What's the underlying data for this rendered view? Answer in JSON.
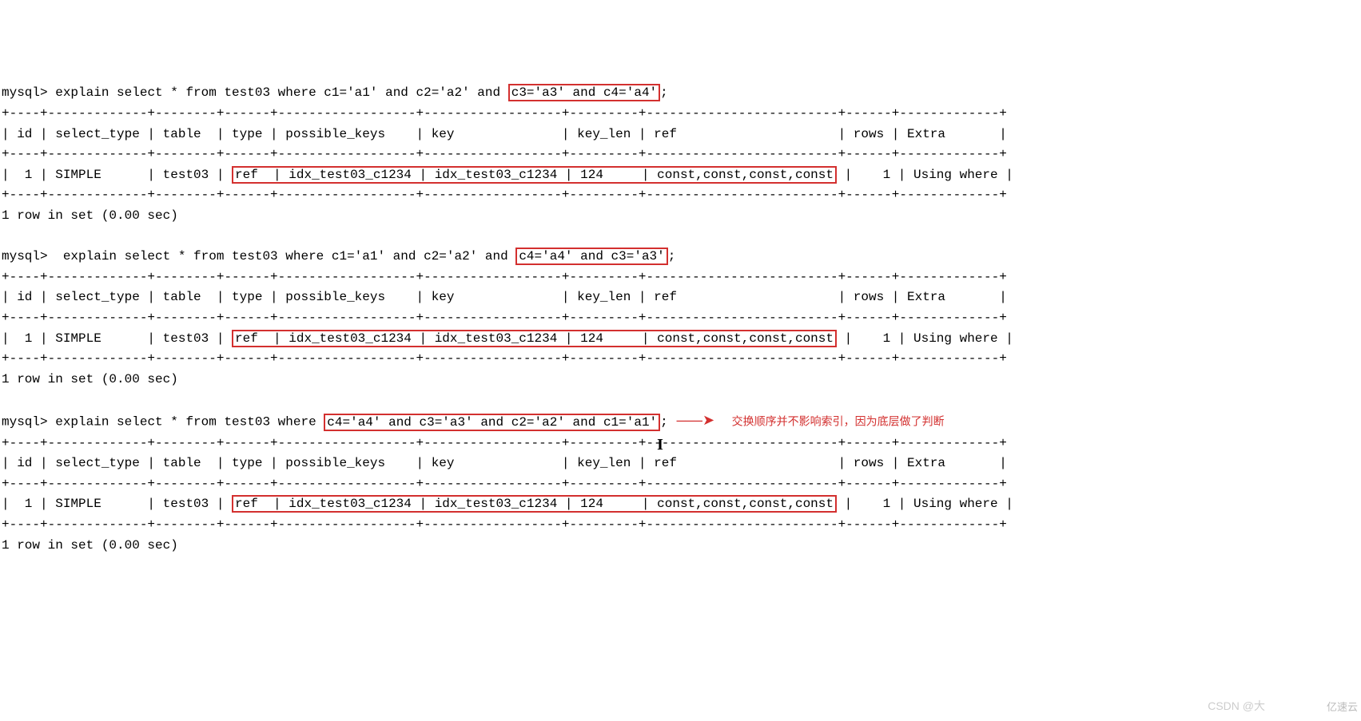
{
  "blocks": [
    {
      "prompt": "mysql> ",
      "query_before": "explain select * from test03 where c1='a1' and c2='a2' and ",
      "query_boxed": "c3='a3' and c4='a4'",
      "query_after": ";",
      "annotation": "",
      "arrow": "",
      "cursor": false,
      "header_border": "+----+-------------+--------+------+------------------+------------------+---------+-------------------------+------+-------------+",
      "header": "| id | select_type | table  | type | possible_keys    | key              | key_len | ref                     | rows | Extra       |",
      "row_left": "|  1 | SIMPLE      | test03 | ",
      "row_boxed": "ref  | idx_test03_c1234 | idx_test03_c1234 | 124     | const,const,const,const",
      "row_right": " |    1 | Using where |",
      "footer": "1 row in set (0.00 sec)"
    },
    {
      "prompt": "mysql>  ",
      "query_before": "explain select * from test03 where c1='a1' and c2='a2' and ",
      "query_boxed": "c4='a4' and c3='a3'",
      "query_after": ";",
      "annotation": "",
      "arrow": "",
      "cursor": false,
      "header_border": "+----+-------------+--------+------+------------------+------------------+---------+-------------------------+------+-------------+",
      "header": "| id | select_type | table  | type | possible_keys    | key              | key_len | ref                     | rows | Extra       |",
      "row_left": "|  1 | SIMPLE      | test03 | ",
      "row_boxed": "ref  | idx_test03_c1234 | idx_test03_c1234 | 124     | const,const,const,const",
      "row_right": " |    1 | Using where |",
      "footer": "1 row in set (0.00 sec)"
    },
    {
      "prompt": "mysql> ",
      "query_before": "explain select * from test03 where ",
      "query_boxed": "c4='a4' and c3='a3' and c2='a2' and c1='a1'",
      "query_after": ";",
      "annotation": "交换顺序并不影响索引，因为底层做了判断",
      "arrow": " ———➤  ",
      "cursor": true,
      "header_border": "+----+-------------+--------+------+------------------+------------------+---------+-------------------------+------+-------------+",
      "header": "| id | select_type | table  | type | possible_keys    | key              | key_len | ref                     | rows | Extra       |",
      "row_left": "|  1 | SIMPLE      | test03 | ",
      "row_boxed": "ref  | idx_test03_c1234 | idx_test03_c1234 | 124     | const,const,const,const",
      "row_right": " |    1 | Using where |",
      "footer": "1 row in set (0.00 sec)"
    }
  ],
  "watermark1": "CSDN @大",
  "watermark2": "亿速云"
}
